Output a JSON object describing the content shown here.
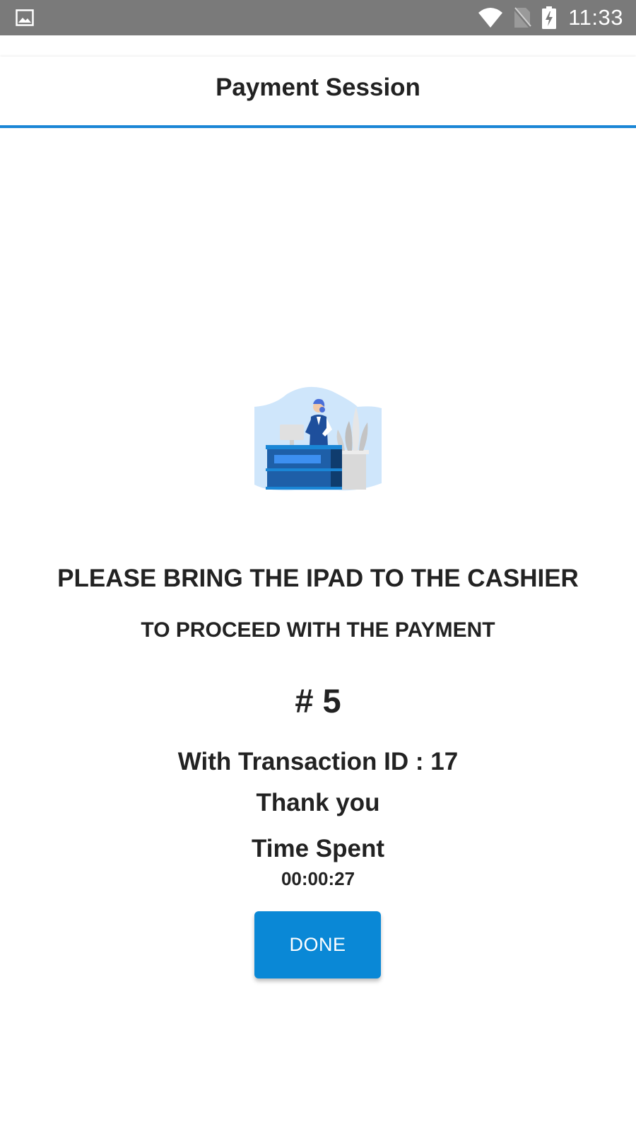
{
  "status_bar": {
    "time": "11:33",
    "icons": [
      "gallery-icon",
      "wifi-icon",
      "no-sim-icon",
      "battery-charging-icon"
    ]
  },
  "header": {
    "title": "Payment Session"
  },
  "illustration": {
    "name": "cashier-illustration"
  },
  "message": {
    "line1": "PLEASE BRING THE IPAD TO THE CASHIER",
    "line2": "TO PROCEED WITH THE PAYMENT",
    "queue_number": "# 5",
    "transaction": "With Transaction ID : 17",
    "thanks": "Thank you",
    "time_spent_label": "Time Spent",
    "time_spent_value": "00:00:27"
  },
  "actions": {
    "done_label": "DONE"
  },
  "colors": {
    "accent": "#1a86d6",
    "button": "#0a88d6",
    "status_bar": "#7a7a7a"
  }
}
